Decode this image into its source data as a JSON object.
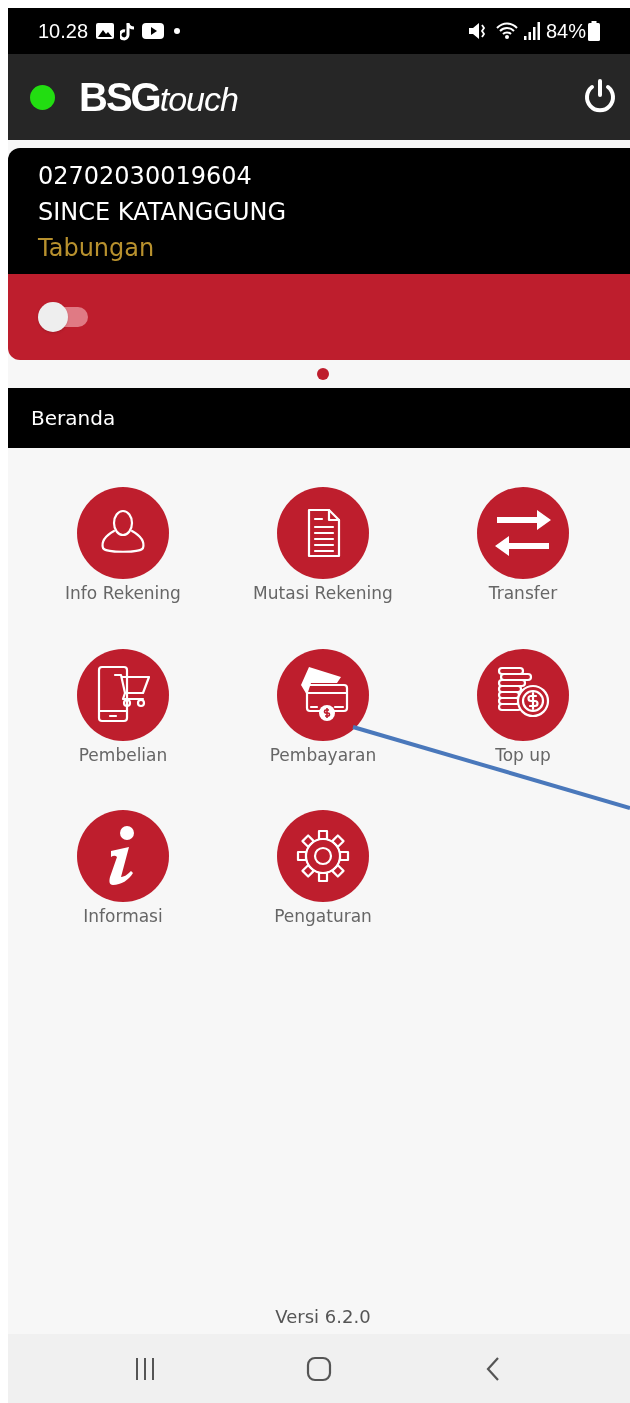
{
  "status_bar": {
    "time": "10.28",
    "battery": "84%"
  },
  "header": {
    "connected": true,
    "logo": {
      "bold": "BSG",
      "italic": "touch"
    }
  },
  "account": {
    "number": "02702030019604",
    "name": "SINCE KATANGGUNG",
    "type": "Tabungan",
    "toggle_on": false
  },
  "section_title": "Beranda",
  "menu": [
    {
      "label": "Info Rekening",
      "kind": "person"
    },
    {
      "label": "Mutasi Rekening",
      "kind": "document"
    },
    {
      "label": "Transfer",
      "kind": "transfer"
    },
    {
      "label": "Pembelian",
      "kind": "shopping"
    },
    {
      "label": "Pembayaran",
      "kind": "payment"
    },
    {
      "label": "Top up",
      "kind": "coins"
    },
    {
      "label": "Informasi",
      "kind": "info"
    },
    {
      "label": "Pengaturan",
      "kind": "gear"
    }
  ],
  "version": "Versi 6.2.0"
}
